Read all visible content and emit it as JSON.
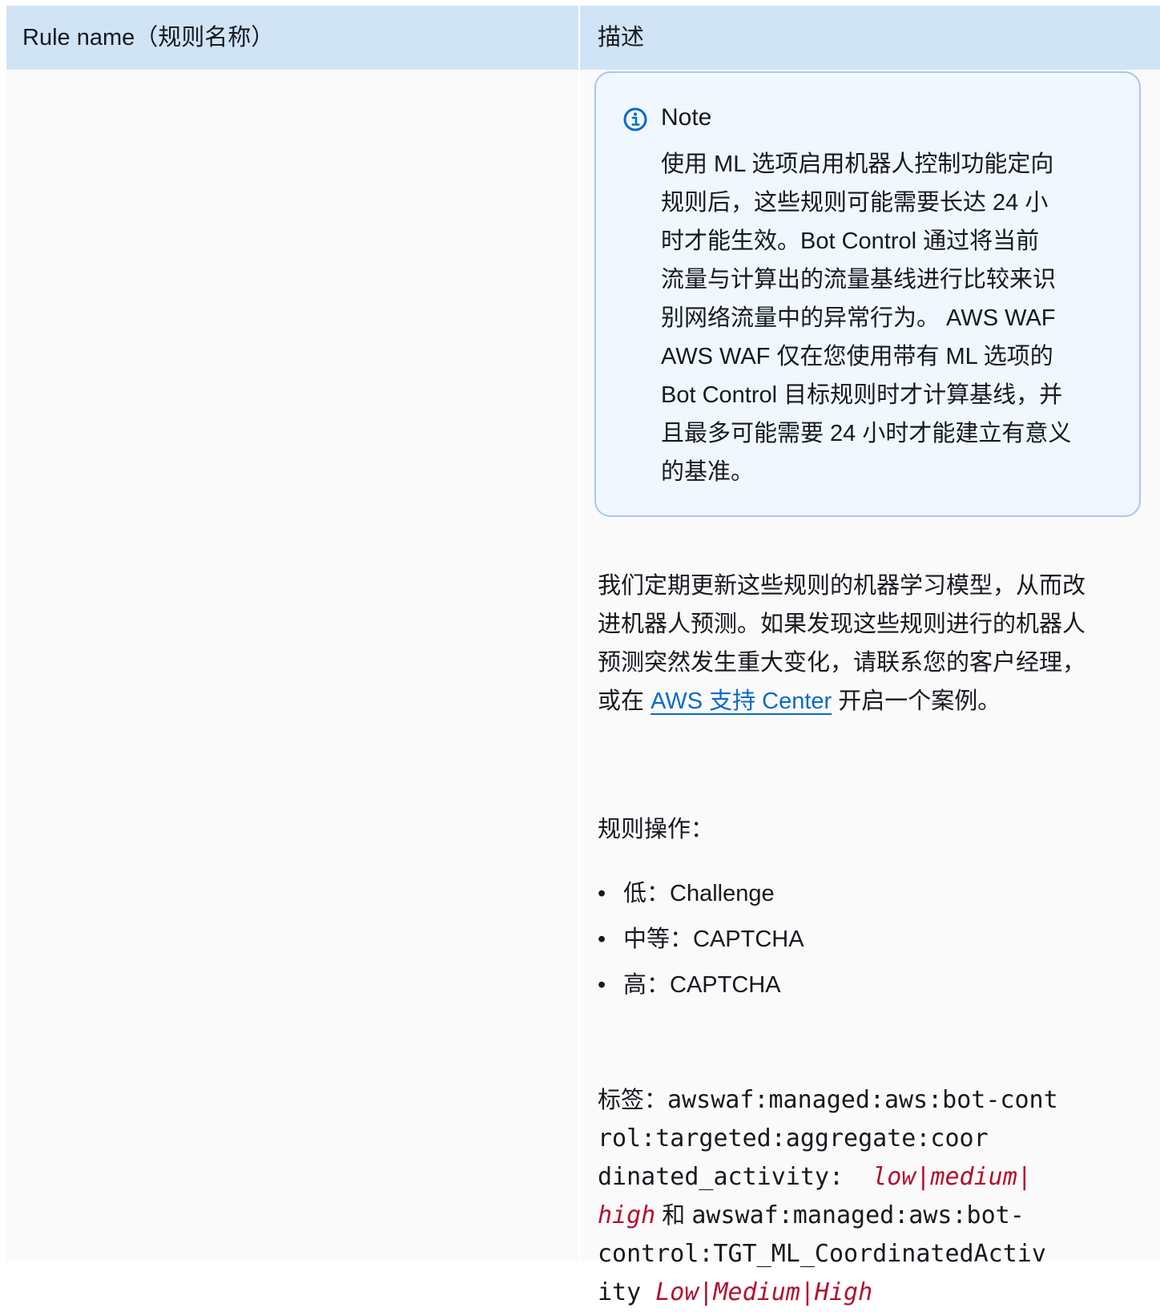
{
  "table": {
    "header": {
      "col_rule_name": "Rule name（规则名称）",
      "col_description": "描述"
    }
  },
  "note": {
    "icon": "info-icon",
    "title": "Note",
    "line1": "使用 ML 选项启用机器人控制功能定向",
    "line2": "规则后，这些规则可能需要长达 24 小",
    "line3": "时才能生效。Bot Control 通过将当前",
    "line4": "流量与计算出的流量基线进行比较来识",
    "line5": "别网络流量中的异常行为。 AWS WAF",
    "line6": "AWS WAF 仅在您使用带有 ML 选项的",
    "line7": "Bot Control 目标规则时才计算基线，并",
    "line8": "且最多可能需要 24 小时才能建立有意义",
    "line9": "的基准。"
  },
  "description": {
    "line1": "我们定期更新这些规则的机器学习模型，从而改",
    "line2": "进机器人预测。如果发现这些规则进行的机器人",
    "line3": "预测突然发生重大变化，请联系您的客户经理，",
    "line4_prefix": "或在 ",
    "support_link": "AWS 支持 Center",
    "line4_suffix": " 开启一个案例。",
    "link_color": "#0a6bc4"
  },
  "actions": {
    "heading": "规则操作：",
    "bullet": "•",
    "items": [
      {
        "label": "低：Challenge"
      },
      {
        "label": "中等：CAPTCHA"
      },
      {
        "label": "高：CAPTCHA"
      }
    ]
  },
  "labels": {
    "prefix": "标签：",
    "label1_line1": "awswaf:managed:aws:bot-cont",
    "label1_line2": "rol:targeted:aggregate:coor",
    "label1_line3": "dinated_activity:  ",
    "label1_var_a": "low|medium|",
    "label1_var_b": "high",
    "joiner": " 和 ",
    "label2_line1": "awswaf:managed:aws:bot-",
    "label2_line2": "control:TGT_ML_CoordinatedActiv",
    "label2_line3": "ity ",
    "label2_var": "Low|Medium|High",
    "variable_color": "#b2102f"
  }
}
